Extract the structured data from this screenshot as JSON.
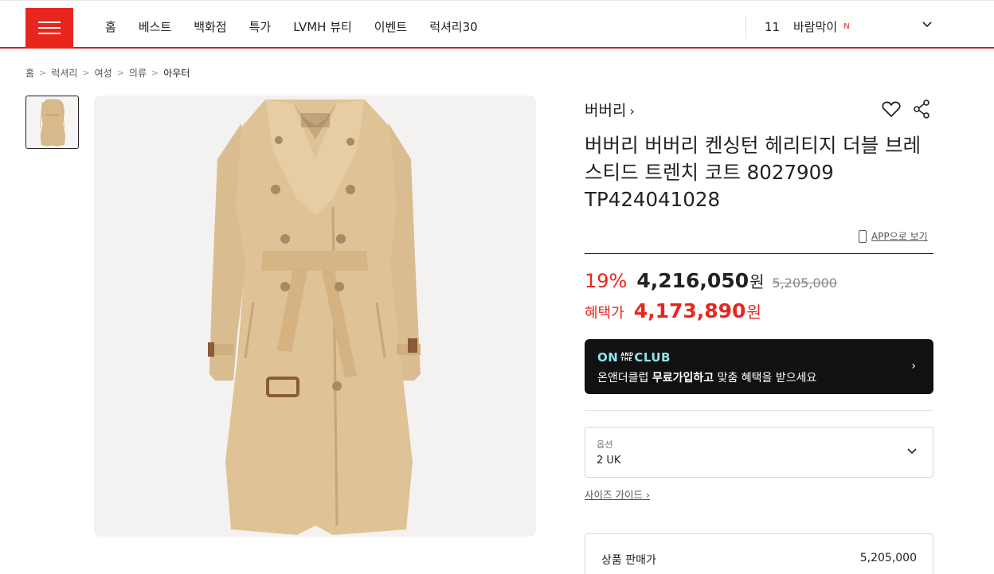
{
  "nav": {
    "items": [
      {
        "label": "홈"
      },
      {
        "label": "베스트"
      },
      {
        "label": "백화점"
      },
      {
        "label": "특가"
      },
      {
        "label": "LVMH 뷰티"
      },
      {
        "label": "이벤트"
      },
      {
        "label": "럭셔리30"
      }
    ],
    "ranking": {
      "rank": "11",
      "term": "바람막이",
      "badge": "N"
    }
  },
  "breadcrumb": [
    "홈",
    "럭셔리",
    "여성",
    "의류",
    "아우터"
  ],
  "product": {
    "brand": "버버리",
    "title": "버버리 버버리 켄싱턴 헤리티지 더블 브레스티드 트렌치 코트 8027909 TP424041028",
    "app_link": "APP으로 보기",
    "discount": "19%",
    "sale_price": "4,216,050",
    "currency": "원",
    "original_price": "5,205,000",
    "benefit_label": "혜택가",
    "benefit_price": "4,173,890"
  },
  "club_banner": {
    "logo_on": "ON",
    "logo_small": "AND THE",
    "logo_club": "CLUB",
    "text_prefix": "온앤더클럽 ",
    "text_bold": "무료가입하고",
    "text_suffix": " 맞춤 혜택을 받으세요"
  },
  "option": {
    "label": "옵션",
    "selected": "2 UK"
  },
  "size_guide": "사이즈 가이드",
  "summary": {
    "label": "상품 판매가",
    "value": "5,205,000"
  },
  "colors": {
    "brand_red": "#e8261e",
    "banner_bg": "#111111",
    "club_cyan": "#8ee6f0"
  },
  "icons": [
    "menu-icon",
    "chevron-down-icon",
    "heart-icon",
    "share-icon",
    "phone-icon",
    "chevron-right-icon"
  ]
}
